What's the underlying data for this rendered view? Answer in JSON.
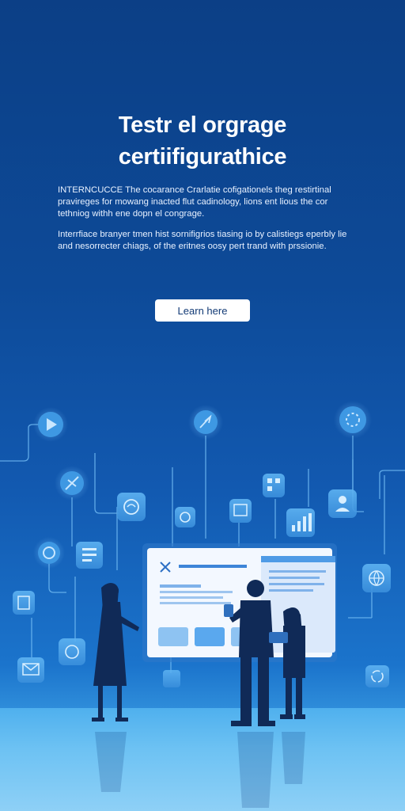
{
  "hero": {
    "title_line1": "Testr el orgrage",
    "title_line2": "certiifigurathice",
    "paragraph1": "INTERNCUCCE The cocarance Crarlatie cofigationels theg restirtinal pravireges for mowang inacted flut cadinology, lions ent lious the cor tethniog withh ene dopn el congrage.",
    "paragraph2": "Interrfiace branyer tmen hist sornifigrios tiasing io by calistiegs eperbly lie and nesorrecter chiags, of the eritnes oosy pert trand with prssionie.",
    "cta_label": "Learn here"
  },
  "colors": {
    "background_top": "#0c3f86",
    "background_bottom": "#6cbdf0",
    "accent": "#4fb0ee",
    "button_bg": "#ffffff",
    "button_text": "#123a75"
  },
  "illustration": {
    "icons": [
      "play-icon",
      "compass-icon",
      "loading-icon",
      "airplane-icon",
      "brain-icon",
      "target-icon",
      "image-icon",
      "qr-code-icon",
      "chart-icon",
      "user-icon",
      "document-icon",
      "circle-icon",
      "clipboard-icon",
      "mail-icon",
      "globe-icon",
      "refresh-icon",
      "cube-icon"
    ],
    "figures": [
      "woman-presenter",
      "man-with-tablet",
      "woman-with-laptop"
    ],
    "screen": "dashboard-screen"
  }
}
